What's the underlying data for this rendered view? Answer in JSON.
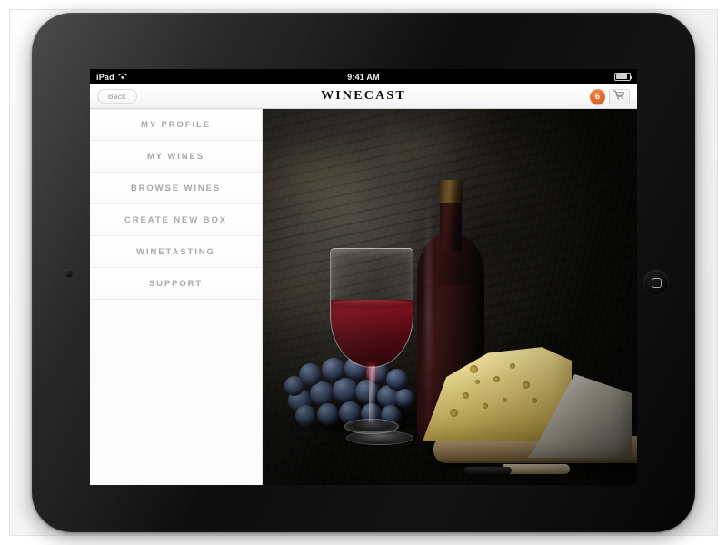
{
  "status_bar": {
    "carrier": "iPad",
    "wifi_icon": "wifi-icon",
    "time": "9:41 AM",
    "battery_icon": "battery-icon"
  },
  "app_bar": {
    "back_label": "Back",
    "title": "WINECAST",
    "cart_count": "6",
    "cart_icon": "shopping-cart-icon"
  },
  "sidebar": {
    "items": [
      {
        "label": "MY PROFILE"
      },
      {
        "label": "MY WINES"
      },
      {
        "label": "BROWSE WINES"
      },
      {
        "label": "CREATE NEW BOX"
      },
      {
        "label": "WINETASTING"
      },
      {
        "label": "SUPPORT"
      }
    ]
  },
  "hero": {
    "alt": "Red wine bottle, filled wine glass, dark grapes and cheese wedges on a wooden board"
  },
  "device": {
    "type": "tablet",
    "orientation": "landscape",
    "camera_icon": "front-camera-icon",
    "home_button_icon": "home-button-icon"
  },
  "colors": {
    "badge_orange": "#e2692a",
    "nav_text": "#a8a8a8",
    "sidebar_bg": "#fcfcfc",
    "app_bar_bg": "#ffffff",
    "device_body": "#0d0d0d",
    "page_bg": "#f2f2f2"
  }
}
